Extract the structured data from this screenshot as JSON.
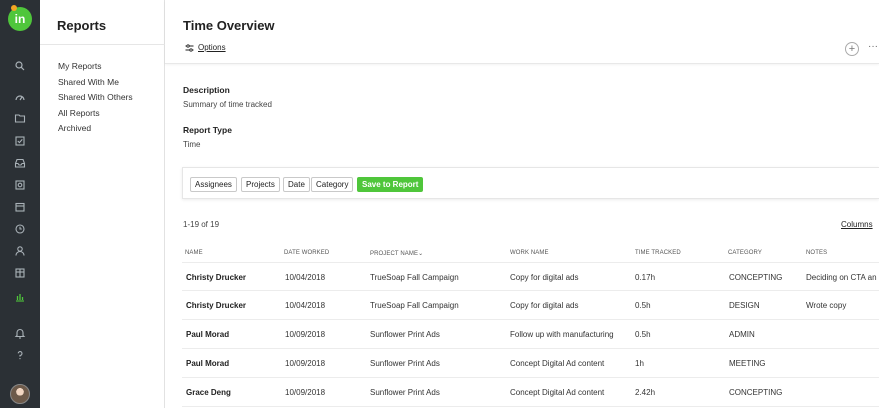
{
  "rail": {
    "logo_text": "in",
    "icons": [
      "search-icon",
      "dashboard-icon",
      "folder-icon",
      "tasks-icon",
      "inbox-icon",
      "proofing-icon",
      "calendar-icon",
      "clock-icon",
      "user-icon",
      "board-icon",
      "reports-icon",
      "bell-icon",
      "help-icon"
    ],
    "accent": "#4fc63b"
  },
  "sidebar": {
    "title": "Reports",
    "items": [
      {
        "label": "My Reports"
      },
      {
        "label": "Shared With Me"
      },
      {
        "label": "Shared With Others"
      },
      {
        "label": "All Reports"
      },
      {
        "label": "Archived"
      }
    ]
  },
  "header": {
    "title": "Time Overview",
    "options_label": "Options",
    "add_label": "+",
    "more_label": "···"
  },
  "details": {
    "description_label": "Description",
    "description_value": "Summary of time tracked",
    "report_type_label": "Report Type",
    "report_type_value": "Time"
  },
  "filters": {
    "chips": [
      {
        "label": "Assignees"
      },
      {
        "label": "Projects"
      },
      {
        "label": "Date"
      },
      {
        "label": "Category"
      }
    ],
    "save_label": "Save to Report"
  },
  "table": {
    "count": "1-19 of 19",
    "columns_link": "Columns",
    "headers": [
      "NAME",
      "DATE WORKED",
      "PROJECT NAME",
      "WORK NAME",
      "TIME TRACKED",
      "CATEGORY",
      "NOTES"
    ],
    "sort_indicator": "⌄",
    "rows": [
      [
        "Christy Drucker",
        "10/04/2018",
        "TrueSoap Fall Campaign",
        "Copy for digital ads",
        "0.17h",
        "CONCEPTING",
        "Deciding on CTA an"
      ],
      [
        "Christy Drucker",
        "10/04/2018",
        "TrueSoap Fall Campaign",
        "Copy for digital ads",
        "0.5h",
        "DESIGN",
        "Wrote copy"
      ],
      [
        "Paul Morad",
        "10/09/2018",
        "Sunflower Print Ads",
        "Follow up with manufacturing",
        "0.5h",
        "ADMIN",
        ""
      ],
      [
        "Paul Morad",
        "10/09/2018",
        "Sunflower Print Ads",
        "Concept Digital Ad content",
        "1h",
        "MEETING",
        ""
      ],
      [
        "Grace Deng",
        "10/09/2018",
        "Sunflower Print Ads",
        "Concept Digital Ad content",
        "2.42h",
        "CONCEPTING",
        ""
      ]
    ]
  }
}
